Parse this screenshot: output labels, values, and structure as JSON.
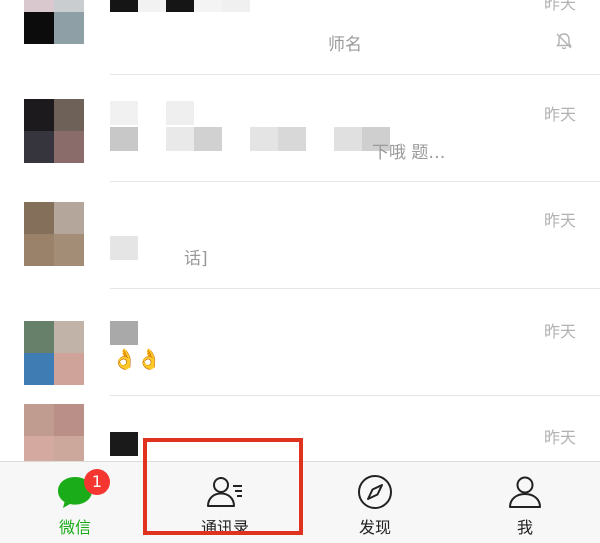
{
  "chats": [
    {
      "time": "昨天",
      "preview": "师名",
      "muted": true
    },
    {
      "time": "昨天",
      "preview": "下哦 题…"
    },
    {
      "time": "昨天",
      "preview": "话]"
    },
    {
      "time": "昨天",
      "preview": "👌👌"
    },
    {
      "time": "昨天",
      "preview": ""
    }
  ],
  "tabbar": {
    "tabs": [
      {
        "label": "微信",
        "icon": "chat-bubble-icon",
        "active": true,
        "badge": "1"
      },
      {
        "label": "通讯录",
        "icon": "contacts-icon",
        "active": false
      },
      {
        "label": "发现",
        "icon": "compass-icon",
        "active": false
      },
      {
        "label": "我",
        "icon": "person-icon",
        "active": false
      }
    ]
  },
  "colors": {
    "accent": "#1aad19",
    "badge": "#f43530",
    "highlight": "#e0331f",
    "time_text": "#b2b2b2"
  }
}
